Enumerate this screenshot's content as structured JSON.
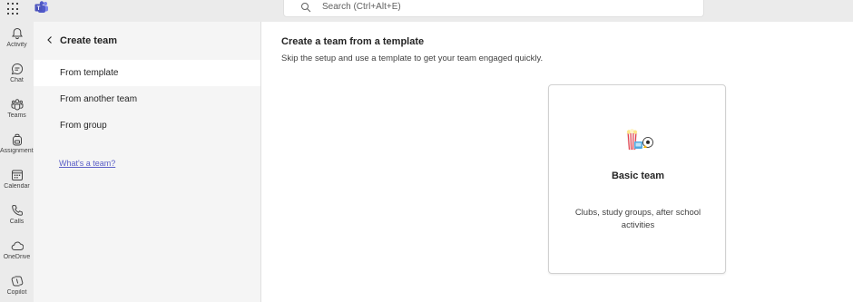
{
  "search": {
    "placeholder": "Search (Ctrl+Alt+E)"
  },
  "rail": {
    "items": [
      {
        "label": "Activity",
        "icon": "bell-icon"
      },
      {
        "label": "Chat",
        "icon": "chat-icon"
      },
      {
        "label": "Teams",
        "icon": "teams-icon"
      },
      {
        "label": "Assignments",
        "icon": "backpack-icon"
      },
      {
        "label": "Calendar",
        "icon": "calendar-icon"
      },
      {
        "label": "Calls",
        "icon": "phone-icon"
      },
      {
        "label": "OneDrive",
        "icon": "cloud-icon"
      },
      {
        "label": "Copilot",
        "icon": "copilot-icon"
      }
    ]
  },
  "panel": {
    "title": "Create team",
    "items": [
      {
        "label": "From template"
      },
      {
        "label": "From another team"
      },
      {
        "label": "From group"
      }
    ],
    "link": "What's a team?"
  },
  "main": {
    "title": "Create a team from a template",
    "subtitle": "Skip the setup and use a template to get your team engaged quickly.",
    "card": {
      "title": "Basic team",
      "description": "Clubs, study groups, after school activities",
      "icon": "basic-team-illustration-icon"
    }
  },
  "colors": {
    "accent": "#5b5fc7",
    "rail_bg": "#ebebeb",
    "panel_bg": "#f5f5f5"
  }
}
